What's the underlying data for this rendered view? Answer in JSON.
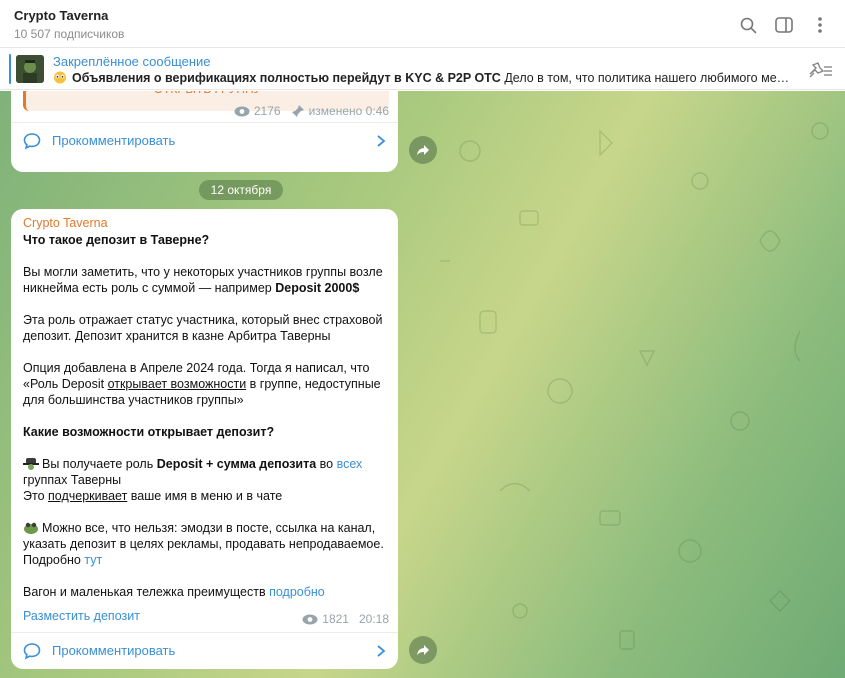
{
  "header": {
    "title": "Crypto Taverna",
    "subscribers": "10 507 подписчиков"
  },
  "pinned": {
    "title": "Закреплённое сообщение",
    "bold": "Объявления о верификациях полностью перейдут в KYC & P2P OTC",
    "text": " Дело в том, что политика нашего любимого мессендж..."
  },
  "msg1": {
    "button": "ОТКРЫТЬ ГРУППУ",
    "views": "2176",
    "edited": "изменено 0:46",
    "comment": "Прокомментировать"
  },
  "date": "12 октября",
  "msg2": {
    "author": "Crypto Taverna",
    "heading": "Что такое депозит в Таверне?",
    "p1a": "Вы могли заметить, что у некоторых участников группы возле никнейма есть роль с суммой — например ",
    "p1b": "Deposit 2000$",
    "p2": "Эта роль отражает статус участника, который внес страховой депозит. Депозит хранится в казне Арбитра Таверны",
    "p3a": "Опция добавлена в Апреле 2024 года. Тогда я написал, что «Роль Deposit ",
    "p3u": "открывает возможности",
    "p3b": " в группе, недоступные для большинства участников группы»",
    "h2": "Какие возможности открывает депозит?",
    "l1a": "Вы получаете роль ",
    "l1b": "Deposit + сумма депозита",
    "l1c": " во ",
    "l1link": "всех",
    "l1d": " группах Таверны",
    "l2a": "Это ",
    "l2u": "подчеркивает",
    "l2b": " ваше имя в меню и в чате",
    "l3": "Можно все, что нельзя: эмодзи в посте, ссылка на канал, указать депозит в целях рекламы, продавать непродаваемое. Подробно ",
    "l3link": "тут",
    "l4": "Вагон и маленькая тележка преимуществ ",
    "l4link": "подробно",
    "inline_button": "Разместить депозит",
    "views": "1821",
    "time": "20:18",
    "comment": "Прокомментировать"
  }
}
